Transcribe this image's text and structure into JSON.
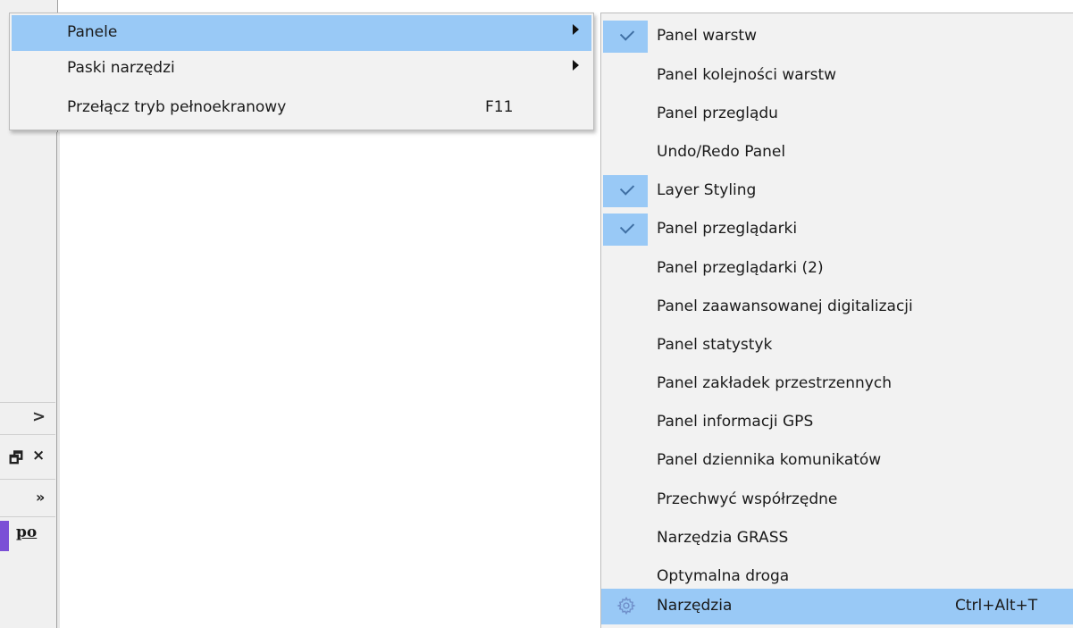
{
  "main_menu": {
    "items": [
      {
        "label": "Panele",
        "has_submenu": true,
        "highlighted": true
      },
      {
        "label": "Paski narzędzi",
        "has_submenu": true,
        "highlighted": false
      },
      {
        "label": "Przełącz tryb pełnoekranowy",
        "shortcut": "F11",
        "highlighted": false
      }
    ]
  },
  "submenu": {
    "items": [
      {
        "label": "Panel warstw",
        "checked": true
      },
      {
        "label": "Panel kolejności warstw",
        "checked": false
      },
      {
        "label": "Panel przeglądu",
        "checked": false
      },
      {
        "label": "Undo/Redo Panel",
        "checked": false
      },
      {
        "label": "Layer Styling",
        "checked": true
      },
      {
        "label": "Panel przeglądarki",
        "checked": true
      },
      {
        "label": "Panel przeglądarki (2)",
        "checked": false
      },
      {
        "label": "Panel zaawansowanej digitalizacji",
        "checked": false
      },
      {
        "label": "Panel statystyk",
        "checked": false
      },
      {
        "label": "Panel zakładek przestrzennych",
        "checked": false
      },
      {
        "label": "Panel informacji GPS",
        "checked": false
      },
      {
        "label": "Panel dziennika komunikatów",
        "checked": false
      },
      {
        "label": "Przechwyć współrzędne",
        "checked": false
      },
      {
        "label": "Narzędzia GRASS",
        "checked": false
      },
      {
        "label": "Optymalna droga",
        "checked": false
      },
      {
        "label": "Narzędzia",
        "checked": false,
        "icon": "gear-icon",
        "shortcut": "Ctrl+Alt+T",
        "highlighted": true
      }
    ]
  },
  "background_window": {
    "chevron": ">",
    "float_button": "🗗",
    "close_button": "×",
    "more_button": "»",
    "tab_label": "po"
  },
  "colors": {
    "highlight": "#99c9f6",
    "menu_bg": "#f2f2f2",
    "check": "#3f6fa3",
    "tab_accent": "#7b4fd6"
  }
}
